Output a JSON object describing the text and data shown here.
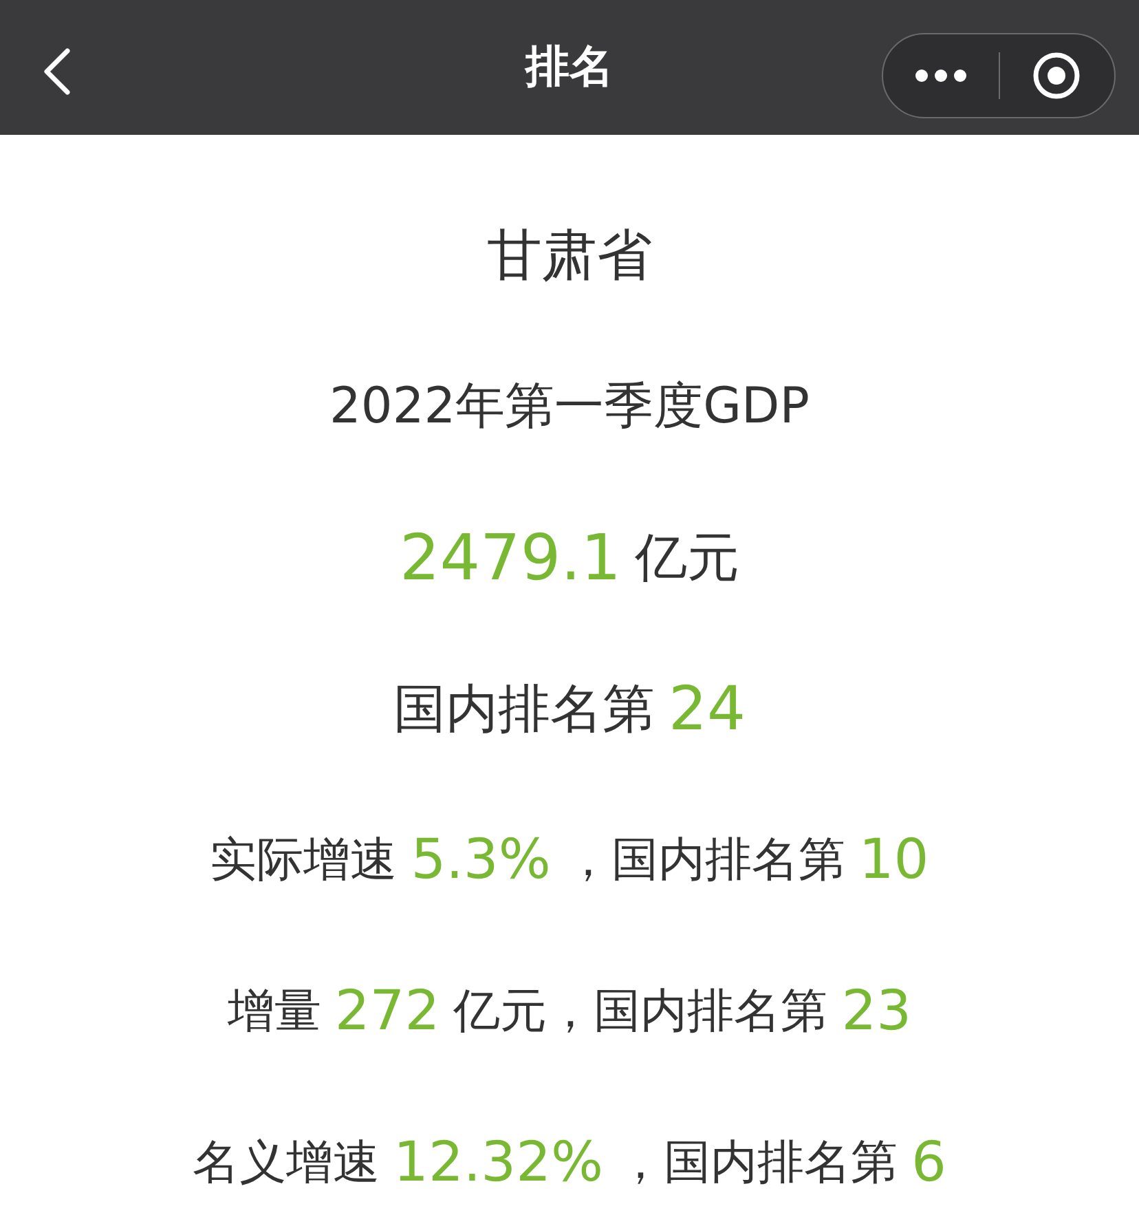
{
  "nav_bar": {
    "title": "排名"
  },
  "lines": [
    {
      "kind": "province",
      "parts": [
        {
          "kind": "label",
          "text": "甘肃省"
        }
      ]
    },
    {
      "kind": "period",
      "parts": [
        {
          "kind": "label",
          "text": "2022年第一季度GDP"
        }
      ]
    },
    {
      "kind": "total",
      "parts": [
        {
          "kind": "value",
          "text": "2479.1"
        },
        {
          "kind": "label",
          "text": "亿元"
        }
      ]
    },
    {
      "kind": "rank",
      "parts": [
        {
          "kind": "label",
          "text": "国内排名第"
        },
        {
          "kind": "value",
          "text": "24"
        }
      ]
    },
    {
      "kind": "stat",
      "parts": [
        {
          "kind": "label",
          "text": "实际增速"
        },
        {
          "kind": "value",
          "text": "5.3%"
        },
        {
          "kind": "label",
          "text": "，国内排名第"
        },
        {
          "kind": "value",
          "text": "10"
        }
      ]
    },
    {
      "kind": "stat",
      "parts": [
        {
          "kind": "label",
          "text": "增量"
        },
        {
          "kind": "value",
          "text": "272"
        },
        {
          "kind": "label",
          "text": "亿元，国内排名第"
        },
        {
          "kind": "value",
          "text": "23"
        }
      ]
    },
    {
      "kind": "stat",
      "parts": [
        {
          "kind": "label",
          "text": "名义增速"
        },
        {
          "kind": "value",
          "text": "12.32%"
        },
        {
          "kind": "label",
          "text": "，国内排名第"
        },
        {
          "kind": "value",
          "text": "6"
        }
      ]
    }
  ]
}
